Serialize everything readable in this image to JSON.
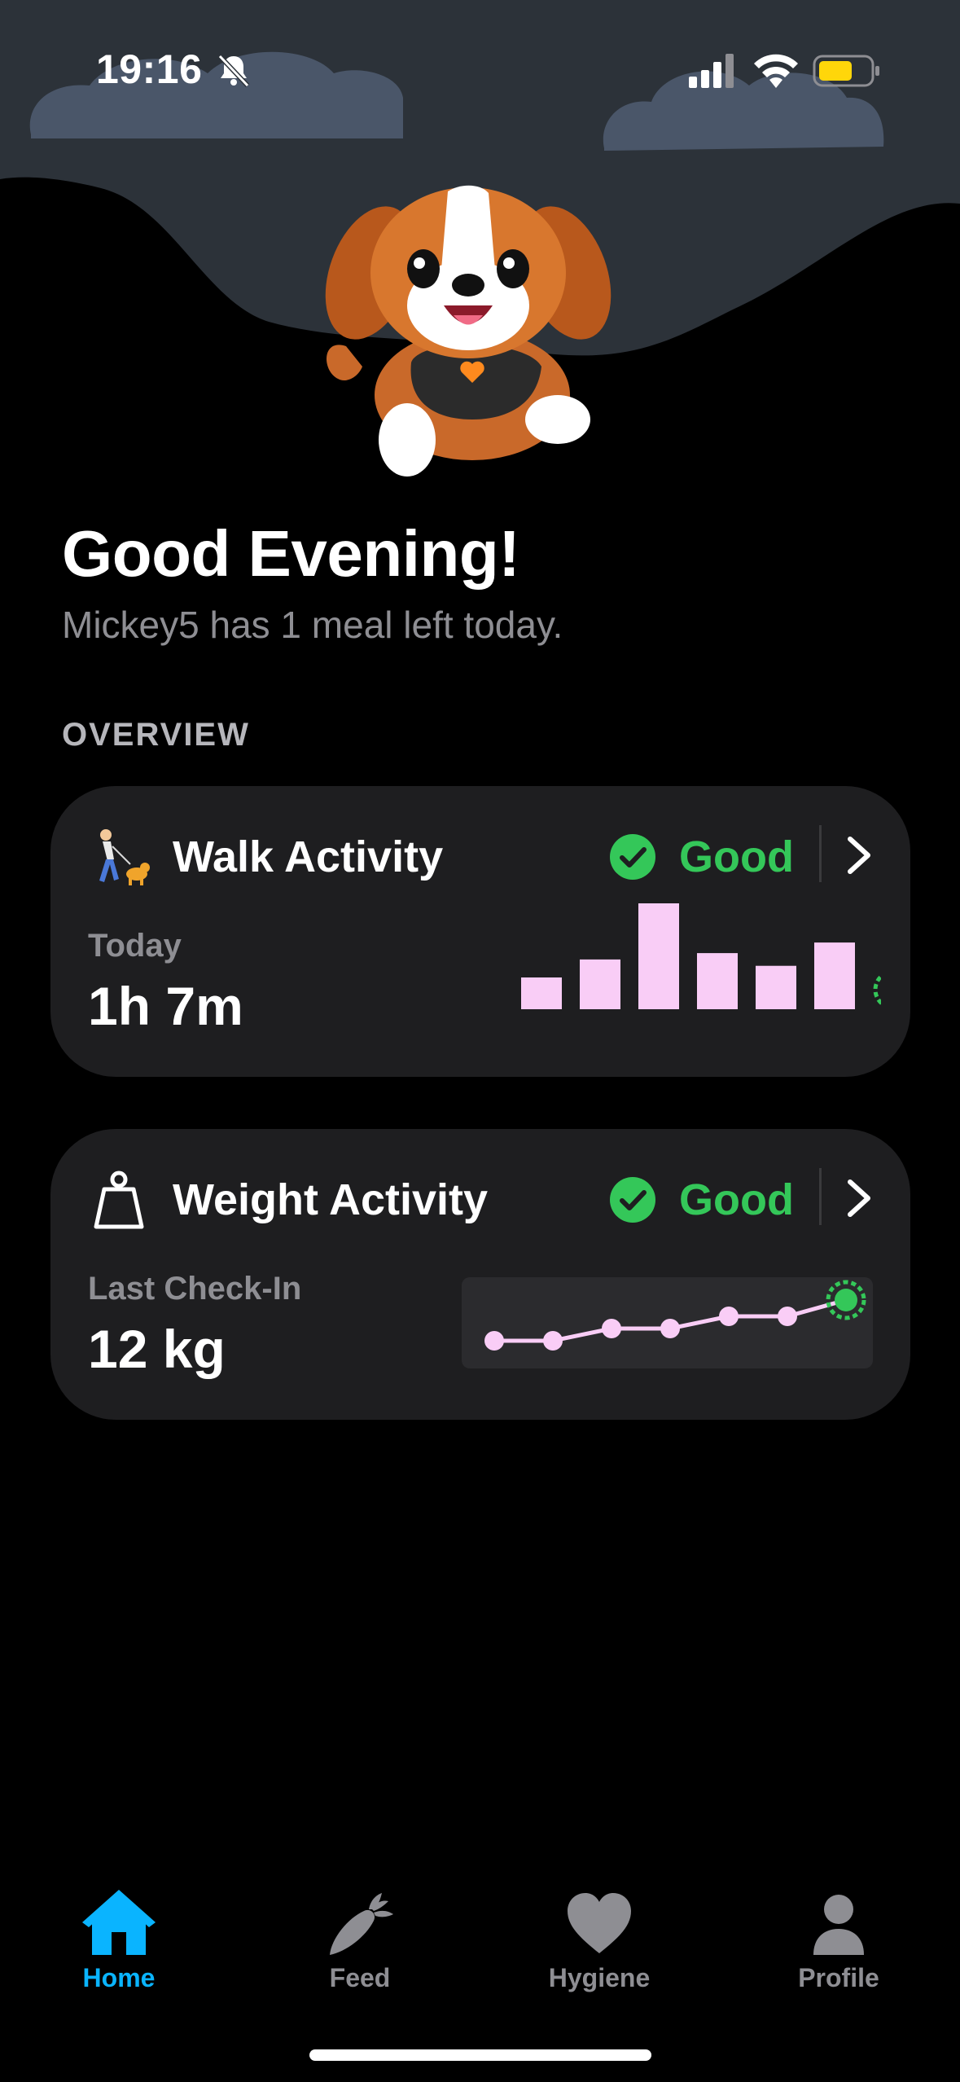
{
  "status_bar": {
    "time": "19:16",
    "bell_icon": "bell-slash-icon",
    "signal_icon": "cellular-signal-icon",
    "wifi_icon": "wifi-icon",
    "battery_icon": "battery-icon",
    "battery_color": "#ffd60a"
  },
  "header": {
    "greeting": "Good Evening!",
    "subtitle": "Mickey5 has 1 meal left today."
  },
  "section_label": "OVERVIEW",
  "walk_card": {
    "title": "Walk Activity",
    "status": "Good",
    "metric_label": "Today",
    "metric_value": "1h 7m",
    "icon": "person-walking-dog-icon"
  },
  "weight_card": {
    "title": "Weight Activity",
    "status": "Good",
    "metric_label": "Last Check-In",
    "metric_value": "12 kg",
    "icon": "weight-icon"
  },
  "chart_data": [
    {
      "type": "bar",
      "name_hint": "walk-activity-mini-chart",
      "values": [
        0.3,
        0.47,
        1.0,
        0.53,
        0.41,
        0.63,
        0.3
      ],
      "bar_color": "#f9cdf6",
      "today_marker_color": "#34c759"
    },
    {
      "type": "line",
      "name_hint": "weight-activity-mini-chart",
      "values": [
        0.2,
        0.2,
        0.35,
        0.35,
        0.5,
        0.5,
        0.7
      ],
      "line_color": "#f9cdf6",
      "today_marker_color": "#34c759"
    }
  ],
  "tabs": [
    {
      "label": "Home",
      "icon": "house-icon",
      "active": true
    },
    {
      "label": "Feed",
      "icon": "carrot-icon",
      "active": false
    },
    {
      "label": "Hygiene",
      "icon": "heart-icon",
      "active": false
    },
    {
      "label": "Profile",
      "icon": "person-icon",
      "active": false
    }
  ],
  "colors": {
    "accent": "#0ab4ff",
    "good": "#34c759",
    "card": "#1e1e20",
    "sky": "#2c3239",
    "cloud": "#4a5669"
  }
}
